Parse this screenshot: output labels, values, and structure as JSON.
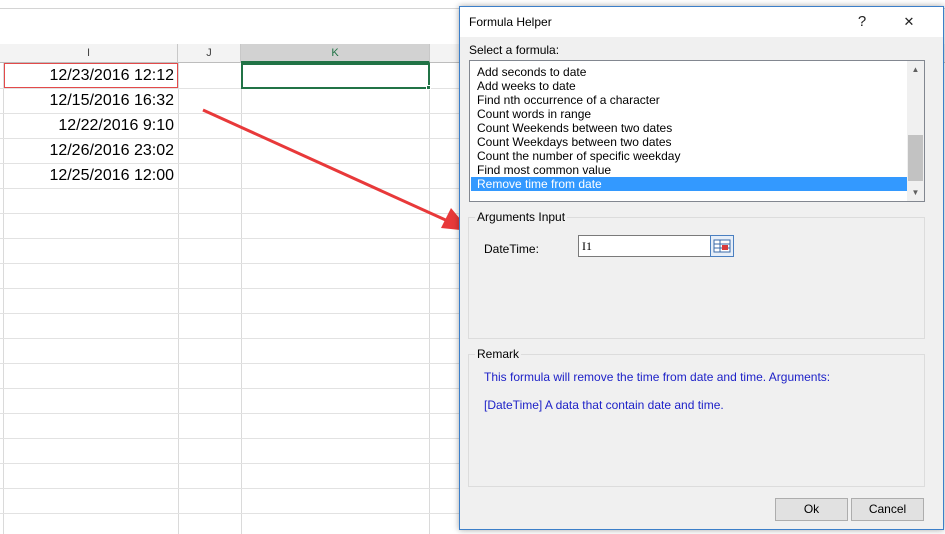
{
  "sheet": {
    "columns": [
      {
        "label": "I",
        "selected": false
      },
      {
        "label": "J",
        "selected": false
      },
      {
        "label": "K",
        "selected": true
      }
    ],
    "column_i_values": [
      "12/23/2016 12:12",
      "12/15/2016 16:32",
      "12/22/2016 9:10",
      "12/26/2016 23:02",
      "12/25/2016 12:00"
    ],
    "reference_color": "#e34a4a",
    "active_color": "#217346"
  },
  "dialog": {
    "title": "Formula Helper",
    "help_glyph": "?",
    "close_glyph": "✕",
    "select_label": "Select a formula:",
    "formulas": [
      {
        "label": "Add seconds to date",
        "selected": false
      },
      {
        "label": "Add weeks to date",
        "selected": false
      },
      {
        "label": "Find nth occurrence of a character",
        "selected": false
      },
      {
        "label": "Count words in range",
        "selected": false
      },
      {
        "label": "Count Weekends between two dates",
        "selected": false
      },
      {
        "label": "Count Weekdays between two dates",
        "selected": false
      },
      {
        "label": "Count the number of specific weekday",
        "selected": false
      },
      {
        "label": "Find most common value",
        "selected": false
      },
      {
        "label": "Remove time from date",
        "selected": true
      }
    ],
    "arguments": {
      "title": "Arguments Input",
      "datetime_label": "DateTime:",
      "datetime_value": "I1"
    },
    "remark": {
      "title": "Remark",
      "line1": "This formula will remove the time from date and time. Arguments:",
      "line2": "[DateTime] A data that contain date and time."
    },
    "ok_label": "Ok",
    "cancel_label": "Cancel"
  }
}
